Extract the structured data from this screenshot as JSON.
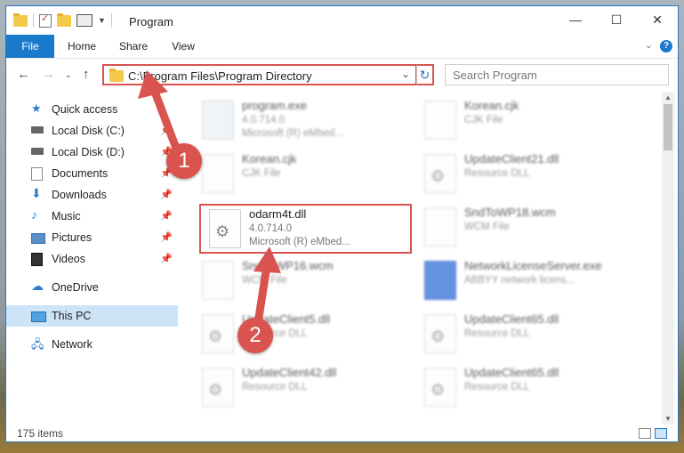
{
  "window": {
    "title": "Program",
    "controls": [
      "—",
      "☐",
      "✕"
    ]
  },
  "ribbon": {
    "tabs": [
      "File",
      "Home",
      "Share",
      "View"
    ],
    "help": "?"
  },
  "address": {
    "path": "C:\\Program Files\\Program Directory",
    "search_placeholder": "Search Program"
  },
  "sidebar": {
    "items": [
      {
        "label": "Quick access",
        "icon": "star-icon"
      },
      {
        "label": "Local Disk (C:)",
        "icon": "drive-icon",
        "pinned": true
      },
      {
        "label": "Local Disk (D:)",
        "icon": "drive-icon",
        "pinned": true
      },
      {
        "label": "Documents",
        "icon": "documents-icon",
        "pinned": true
      },
      {
        "label": "Downloads",
        "icon": "download-icon",
        "pinned": true
      },
      {
        "label": "Music",
        "icon": "music-icon",
        "pinned": true
      },
      {
        "label": "Pictures",
        "icon": "pictures-icon",
        "pinned": true
      },
      {
        "label": "Videos",
        "icon": "videos-icon",
        "pinned": true
      },
      {
        "label": "OneDrive",
        "icon": "cloud-icon"
      },
      {
        "label": "This PC",
        "icon": "computer-icon",
        "selected": true
      },
      {
        "label": "Network",
        "icon": "network-icon"
      }
    ]
  },
  "files": [
    {
      "name": "program.exe",
      "line2": "4.0.714.0",
      "line3": "Microsoft (R) eMbed...",
      "icon": "exe-icon"
    },
    {
      "name": "Korean.cjk",
      "line2": "CJK File",
      "line3": "",
      "icon": "file-icon"
    },
    {
      "name": "Korean.cjk",
      "line2": "CJK File",
      "line3": "",
      "icon": "file-icon"
    },
    {
      "name": "UpdateClient21.dll",
      "line2": "Resource DLL",
      "line3": "",
      "icon": "dll-icon"
    },
    {
      "name": "odarm4t.dll",
      "line2": "4.0.714.0",
      "line3": "Microsoft (R) eMbed...",
      "icon": "dll-icon"
    },
    {
      "name": "SndToWP18.wcm",
      "line2": "WCM File",
      "line3": "",
      "icon": "file-icon"
    },
    {
      "name": "SndToWP16.wcm",
      "line2": "WCM File",
      "line3": "",
      "icon": "file-icon"
    },
    {
      "name": "NetworkLicenseServer.exe",
      "line2": "ABBYY network licens...",
      "line3": "",
      "icon": "app-icon"
    },
    {
      "name": "UpdateClient5.dll",
      "line2": "Resource DLL",
      "line3": "",
      "icon": "dll-icon"
    },
    {
      "name": "UpdateClient65.dll",
      "line2": "Resource DLL",
      "line3": "",
      "icon": "dll-icon"
    },
    {
      "name": "UpdateClient42.dll",
      "line2": "Resource DLL",
      "line3": "",
      "icon": "dll-icon"
    },
    {
      "name": "UpdateClient65.dll",
      "line2": "Resource DLL",
      "line3": "",
      "icon": "dll-icon"
    }
  ],
  "status": {
    "count": "175 items"
  },
  "annotations": {
    "step1": "1",
    "step2": "2",
    "color": "#d9534f"
  }
}
